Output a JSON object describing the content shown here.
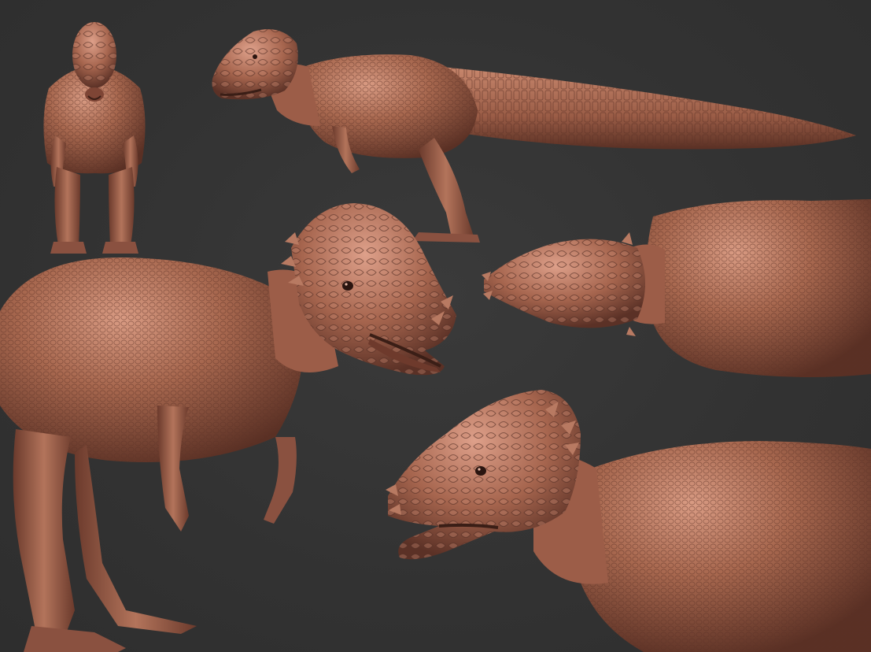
{
  "scene": {
    "background_color": "#333333",
    "skin_base_color": "#9a5e4c",
    "skin_highlight_color": "#d89a82",
    "skin_shadow_color": "#4e2a20",
    "views": [
      {
        "name": "front-view"
      },
      {
        "name": "side-view"
      },
      {
        "name": "three-quarter-view"
      },
      {
        "name": "top-view"
      },
      {
        "name": "head-closeup-view"
      }
    ]
  }
}
